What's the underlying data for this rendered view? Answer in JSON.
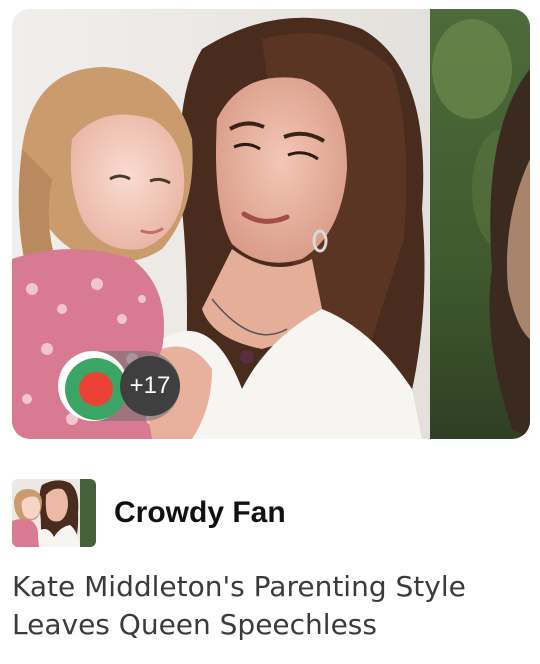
{
  "hero": {
    "image_icon": "photo-woman-holding-child"
  },
  "reactions": {
    "icon": "red-green-reaction-dot",
    "count_label": "+17",
    "colors": {
      "green": "#3aa565",
      "red": "#ea4335"
    }
  },
  "source": {
    "name": "Crowdy Fan",
    "thumbnail_icon": "source-thumbnail-photo"
  },
  "article": {
    "title": "Kate Middleton's Parenting Style Leaves Queen Speechless"
  }
}
